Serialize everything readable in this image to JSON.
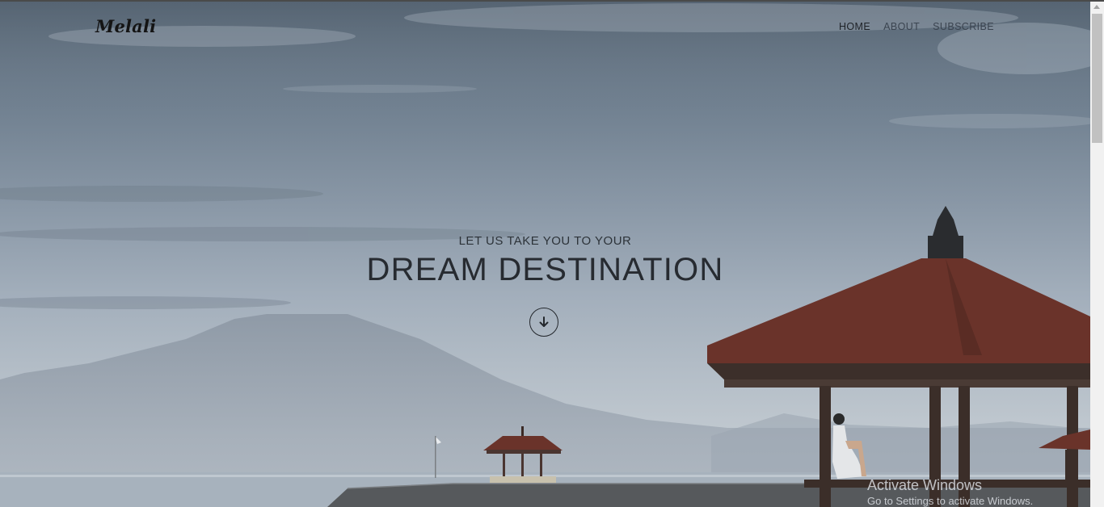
{
  "brand": {
    "logo_text": "Melali"
  },
  "nav": {
    "items": [
      {
        "label": "HOME",
        "active": true
      },
      {
        "label": "ABOUT",
        "active": false
      },
      {
        "label": "SUBSCRIBE",
        "active": false
      }
    ]
  },
  "hero": {
    "subtitle": "LET US TAKE YOU TO YOUR",
    "title": "DREAM DESTINATION",
    "scroll_icon": "arrow-down-circle-icon"
  },
  "watermark": {
    "title": "Activate Windows",
    "subtitle": "Go to Settings to activate Windows."
  },
  "colors": {
    "text_dark": "#272b31",
    "nav_text": "#3b4450",
    "roof": "#6a332a",
    "scrollbar_track": "#f1f1f1",
    "scrollbar_thumb": "#c1c1c1"
  }
}
